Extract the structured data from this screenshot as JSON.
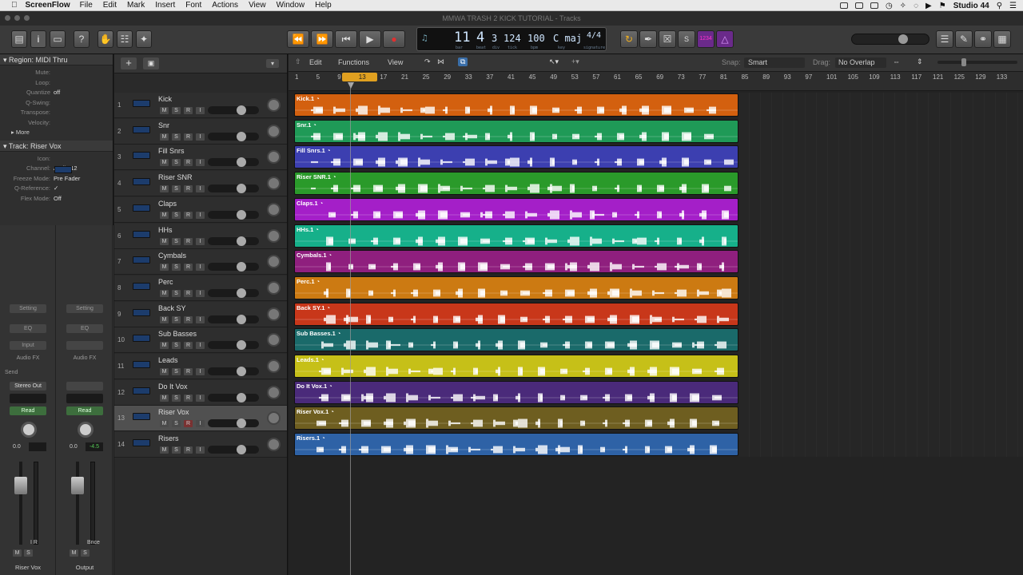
{
  "menubar": {
    "app": "ScreenFlow",
    "items": [
      "File",
      "Edit",
      "Mark",
      "Insert",
      "Font",
      "Actions",
      "View",
      "Window",
      "Help"
    ],
    "right": "Studio 44"
  },
  "window": {
    "title": "MMWA TRASH 2 KICK TUTORIAL - Tracks"
  },
  "lcd": {
    "bar": "11",
    "beat": "4",
    "div": "3",
    "tick": "124",
    "tempo": "100",
    "key": "C maj",
    "sig": "4/4",
    "bar_l": "bar",
    "beat_l": "beat",
    "div_l": "div",
    "tick_l": "tick",
    "bpm_l": "bpm",
    "key_l": "key",
    "sig_l": "signature"
  },
  "toolbar": {
    "cycle_count": "1234"
  },
  "inspector": {
    "region_header": "Region: MIDI Thru",
    "region_params": [
      {
        "k": "Mute:",
        "v": ""
      },
      {
        "k": "Loop:",
        "v": ""
      },
      {
        "k": "Quantize",
        "v": "off"
      },
      {
        "k": "Q-Swing:",
        "v": ""
      },
      {
        "k": "Transpose:",
        "v": ""
      },
      {
        "k": "Velocity:",
        "v": ""
      }
    ],
    "more": "More",
    "track_header": "Track:  Riser Vox",
    "track_params": [
      {
        "k": "Icon:",
        "v": ""
      },
      {
        "k": "Channel:",
        "v": "Audio 12"
      },
      {
        "k": "Freeze Mode:",
        "v": "Pre Fader"
      },
      {
        "k": "Q-Reference:",
        "v": "✓"
      },
      {
        "k": "Flex Mode:",
        "v": "Off"
      }
    ]
  },
  "strips": [
    {
      "setting": "Setting",
      "eq": "EQ",
      "input": "Input",
      "fx": "Audio FX",
      "send": "Send",
      "out": "Stereo Out",
      "auto": "Read",
      "vol": "0.0",
      "peak": "",
      "name": "Riser Vox",
      "ir": "I  R"
    },
    {
      "setting": "Setting",
      "eq": "EQ",
      "input": "",
      "fx": "Audio FX",
      "send": "",
      "out": "",
      "auto": "Read",
      "vol": "0.0",
      "peak": "-4.5",
      "name": "Output",
      "ir": "Bnce"
    }
  ],
  "tracklist": {
    "track_btns": [
      "M",
      "S",
      "R",
      "I"
    ]
  },
  "tracks": [
    {
      "n": "1",
      "name": "Kick",
      "region": "Kick.1",
      "color": "#d3600f"
    },
    {
      "n": "2",
      "name": "Snr",
      "region": "Snr.1",
      "color": "#1f9a57"
    },
    {
      "n": "3",
      "name": "Fill Snrs",
      "region": "Fill Snrs.1",
      "color": "#3c3fb0"
    },
    {
      "n": "4",
      "name": "Riser SNR",
      "region": "Riser SNR.1",
      "color": "#2a9a2a"
    },
    {
      "n": "5",
      "name": "Claps",
      "region": "Claps.1",
      "color": "#a41fc8"
    },
    {
      "n": "6",
      "name": "HHs",
      "region": "HHs.1",
      "color": "#16b08a"
    },
    {
      "n": "7",
      "name": "Cymbals",
      "region": "Cymbals.1",
      "color": "#8f1f7e"
    },
    {
      "n": "8",
      "name": "Perc",
      "region": "Perc.1",
      "color": "#cc7a12"
    },
    {
      "n": "9",
      "name": "Back SY",
      "region": "Back SY.1",
      "color": "#c8371a"
    },
    {
      "n": "10",
      "name": "Sub Basses",
      "region": "Sub Basses.1",
      "color": "#1a6a6a"
    },
    {
      "n": "11",
      "name": "Leads",
      "region": "Leads.1",
      "color": "#c6c018"
    },
    {
      "n": "12",
      "name": "Do It Vox",
      "region": "Do It Vox.1",
      "color": "#4a2a7a"
    },
    {
      "n": "13",
      "name": "Riser Vox",
      "region": "Riser Vox.1",
      "color": "#6e5e20"
    },
    {
      "n": "14",
      "name": "Risers",
      "region": "Risers.1",
      "color": "#2e62a6"
    }
  ],
  "localbar": {
    "edit": "Edit",
    "functions": "Functions",
    "view": "View",
    "snap_label": "Snap:",
    "snap": "Smart",
    "drag_label": "Drag:",
    "drag": "No Overlap"
  },
  "ruler": [
    "1",
    "5",
    "9",
    "13",
    "17",
    "21",
    "25",
    "29",
    "33",
    "37",
    "41",
    "45",
    "49",
    "53",
    "57",
    "61",
    "65",
    "69",
    "73",
    "77",
    "81",
    "85",
    "89",
    "93",
    "97",
    "101",
    "105",
    "109",
    "113",
    "117",
    "121",
    "125",
    "129",
    "133"
  ],
  "colors": {
    "accent": "#f0a020",
    "lcd": "#cfe6ff"
  }
}
